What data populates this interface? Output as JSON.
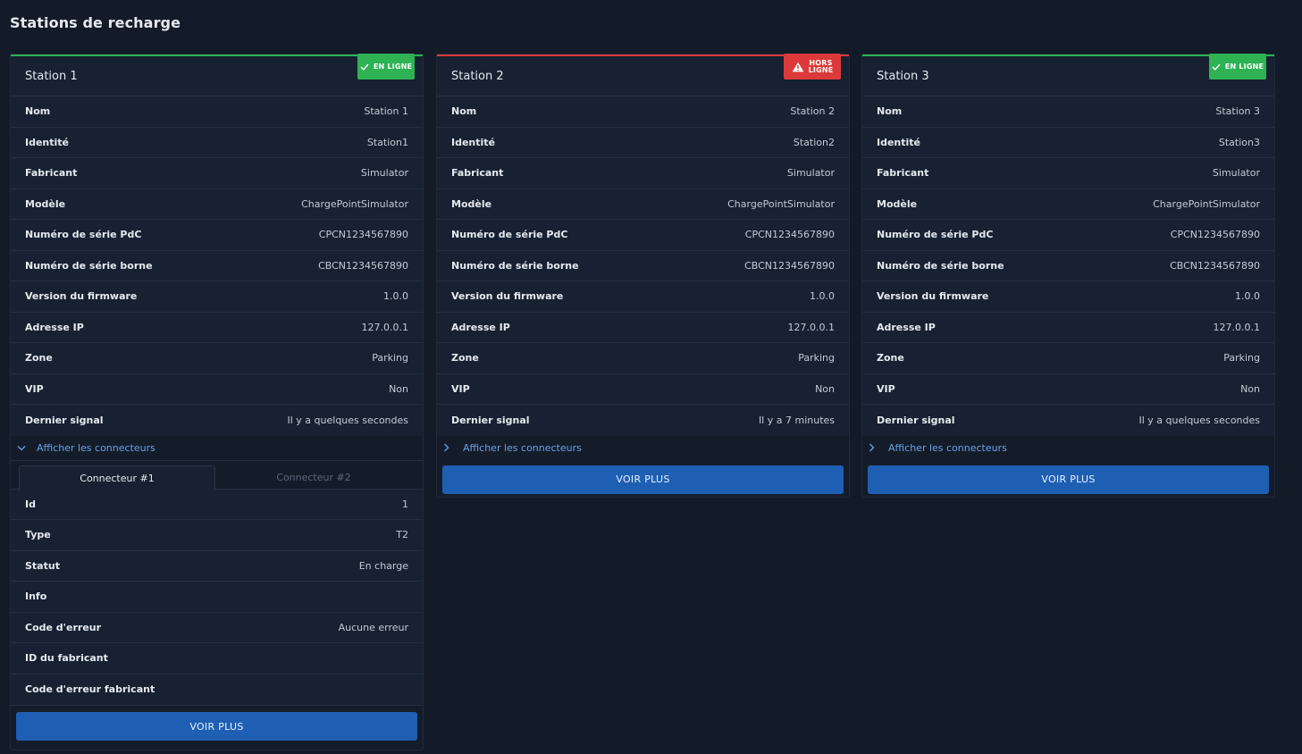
{
  "page": {
    "title": "Stations de recharge"
  },
  "labels": {
    "nom": "Nom",
    "identite": "Identité",
    "fabricant": "Fabricant",
    "modele": "Modèle",
    "serie_pdc": "Numéro de série PdC",
    "serie_borne": "Numéro de série borne",
    "firmware": "Version du firmware",
    "ip": "Adresse IP",
    "zone": "Zone",
    "vip": "VIP",
    "dernier_signal": "Dernier signal",
    "toggle_connectors": "Afficher les connecteurs",
    "voir_plus": "VOIR PLUS"
  },
  "status": {
    "online": "EN LIGNE",
    "offline_line1": "HORS",
    "offline_line2": "LIGNE",
    "colors": {
      "online": "#2eb254",
      "offline": "#dc3a3a",
      "accent": "#1e5fb3"
    }
  },
  "stations": [
    {
      "title": "Station 1",
      "nom": "Station 1",
      "identite": "Station1",
      "fabricant": "Simulator",
      "modele": "ChargePointSimulator",
      "serie_pdc": "CPCN1234567890",
      "serie_borne": "CBCN1234567890",
      "firmware": "1.0.0",
      "ip": "127.0.0.1",
      "zone": "Parking",
      "vip": "Non",
      "dernier_signal": "Il y a quelques secondes"
    },
    {
      "title": "Station 2",
      "nom": "Station 2",
      "identite": "Station2",
      "fabricant": "Simulator",
      "modele": "ChargePointSimulator",
      "serie_pdc": "CPCN1234567890",
      "serie_borne": "CBCN1234567890",
      "firmware": "1.0.0",
      "ip": "127.0.0.1",
      "zone": "Parking",
      "vip": "Non",
      "dernier_signal": "Il y a 7 minutes"
    },
    {
      "title": "Station 3",
      "nom": "Station 3",
      "identite": "Station3",
      "fabricant": "Simulator",
      "modele": "ChargePointSimulator",
      "serie_pdc": "CPCN1234567890",
      "serie_borne": "CBCN1234567890",
      "firmware": "1.0.0",
      "ip": "127.0.0.1",
      "zone": "Parking",
      "vip": "Non",
      "dernier_signal": "Il y a quelques secondes"
    }
  ],
  "connector": {
    "tabs": [
      "Connecteur #1",
      "Connecteur #2"
    ],
    "labels": {
      "id": "Id",
      "type": "Type",
      "statut": "Statut",
      "info": "Info",
      "code_erreur": "Code d'erreur",
      "id_fabricant": "ID du fabricant",
      "code_erreur_fabricant": "Code d'erreur fabricant"
    },
    "values": {
      "id": "1",
      "type": "T2",
      "statut": "En charge",
      "info": "",
      "code_erreur": "Aucune erreur",
      "id_fabricant": "",
      "code_erreur_fabricant": ""
    }
  }
}
